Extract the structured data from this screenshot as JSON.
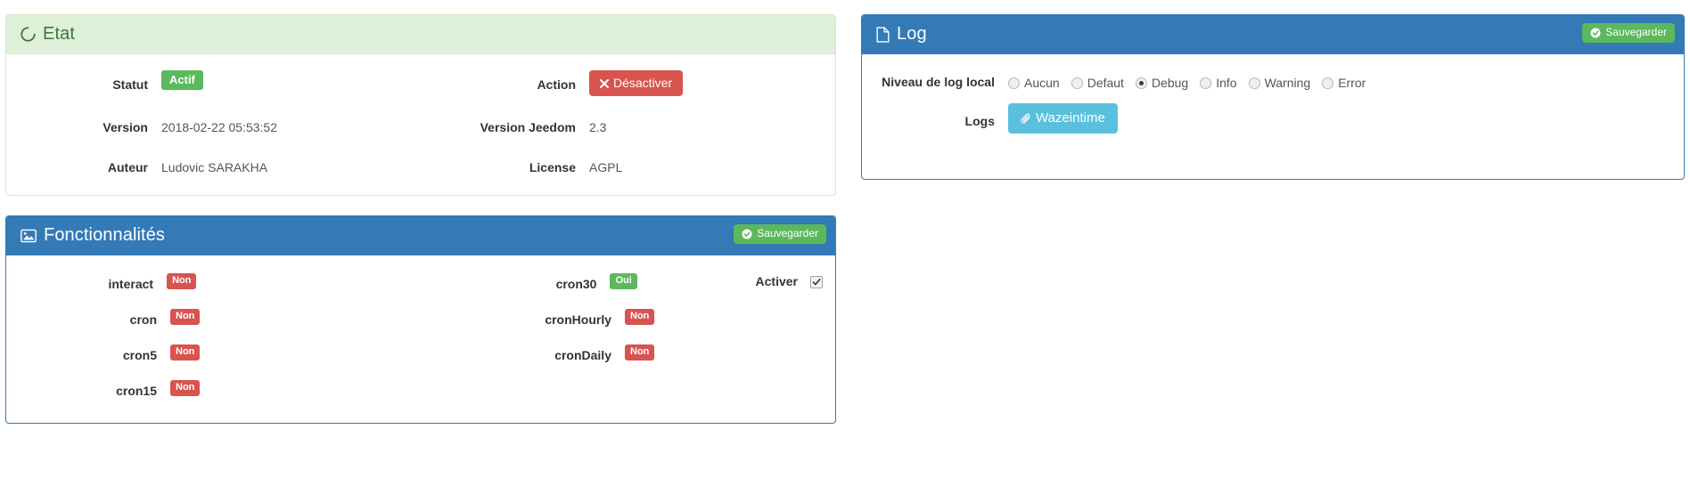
{
  "etat": {
    "title": "Etat",
    "icon": "circle-notch-icon",
    "rows": [
      {
        "label_left": "Statut",
        "value_left": "Actif",
        "value_left_kind": "badge-success",
        "label_right": "Action",
        "value_right": "Désactiver",
        "value_right_kind": "button-danger",
        "value_right_icon": "times-icon"
      },
      {
        "label_left": "Version",
        "value_left": "2018-02-22 05:53:52",
        "value_left_kind": "text",
        "label_right": "Version Jeedom",
        "value_right": "2.3",
        "value_right_kind": "text"
      },
      {
        "label_left": "Auteur",
        "value_left": "Ludovic SARAKHA",
        "value_left_kind": "text",
        "label_right": "License",
        "value_right": "AGPL",
        "value_right_kind": "text"
      }
    ]
  },
  "log": {
    "title": "Log",
    "icon": "file-icon",
    "save_label": "Sauvegarder",
    "save_icon": "check-circle-icon",
    "level_label": "Niveau de log local",
    "levels": [
      {
        "label": "Aucun",
        "selected": false
      },
      {
        "label": "Defaut",
        "selected": false
      },
      {
        "label": "Debug",
        "selected": true
      },
      {
        "label": "Info",
        "selected": false
      },
      {
        "label": "Warning",
        "selected": false
      },
      {
        "label": "Error",
        "selected": false
      }
    ],
    "logs_label": "Logs",
    "logs_button": "Wazeintime",
    "logs_button_icon": "paperclip-icon"
  },
  "fonctionnalites": {
    "title": "Fonctionnalités",
    "icon": "picture-icon",
    "save_label": "Sauvegarder",
    "save_icon": "check-circle-icon",
    "left_column": [
      {
        "label": "interact",
        "value": "Non",
        "kind": "danger"
      },
      {
        "label": "cron",
        "value": "Non",
        "kind": "danger"
      },
      {
        "label": "cron5",
        "value": "Non",
        "kind": "danger"
      },
      {
        "label": "cron15",
        "value": "Non",
        "kind": "danger"
      }
    ],
    "middle_column": [
      {
        "label": "cron30",
        "value": "Oui",
        "kind": "success"
      },
      {
        "label": "cronHourly",
        "value": "Non",
        "kind": "danger"
      },
      {
        "label": "cronDaily",
        "value": "Non",
        "kind": "danger"
      }
    ],
    "activer_label": "Activer",
    "activer_checked": true
  },
  "colors": {
    "panel_primary": "#337ab7",
    "panel_success_bg": "#dff0d8",
    "panel_success_text": "#3c763d",
    "panel_success_border": "#d6e9c6",
    "badge_success": "#5cb85c",
    "badge_danger": "#d9534f",
    "button_info": "#5bc0de"
  }
}
